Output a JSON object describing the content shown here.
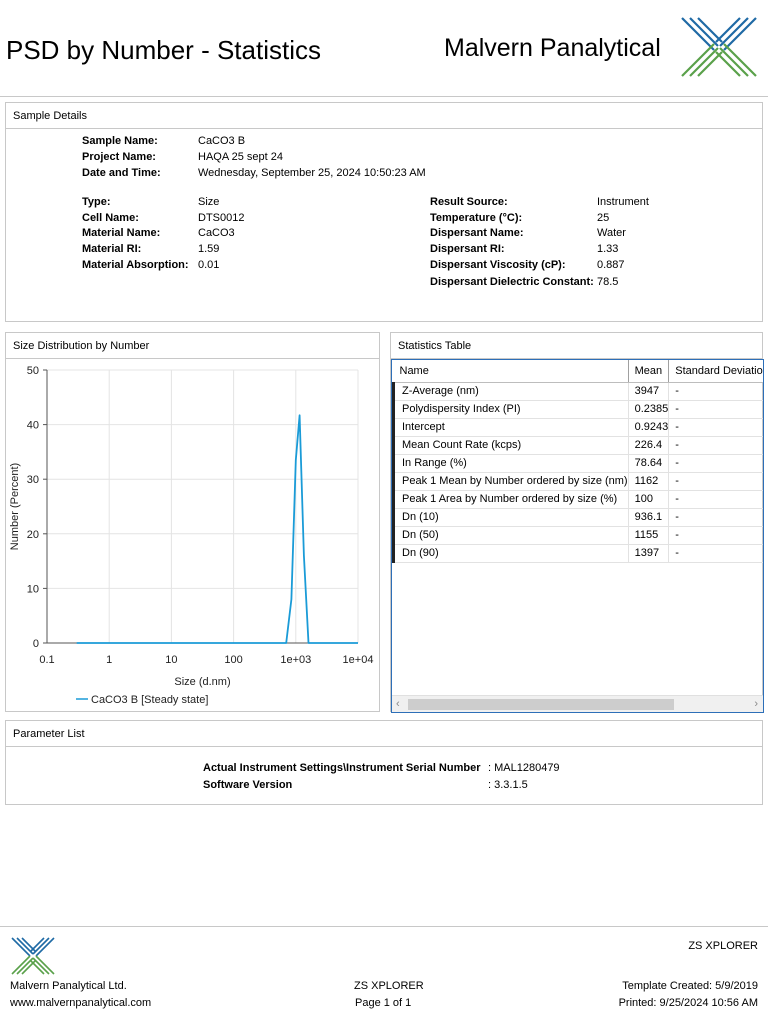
{
  "header": {
    "title": "PSD by Number - Statistics",
    "brand": "Malvern Panalytical"
  },
  "sample_details": {
    "panel_title": "Sample Details",
    "rows": [
      {
        "label": "Sample Name:",
        "value": "CaCO3 B"
      },
      {
        "label": "Project Name:",
        "value": "HAQA 25 sept 24"
      },
      {
        "label": "Date and Time:",
        "value": "Wednesday, September 25, 2024 10:50:23 AM"
      }
    ],
    "left_rows": [
      {
        "label": "Type:",
        "value": "Size"
      },
      {
        "label": "Cell Name:",
        "value": "DTS0012"
      },
      {
        "label": "Material Name:",
        "value": "CaCO3"
      },
      {
        "label": "Material RI:",
        "value": "1.59"
      },
      {
        "label": "Material Absorption:",
        "value": "0.01"
      }
    ],
    "right_rows": [
      {
        "label": "Result Source:",
        "value": "Instrument"
      },
      {
        "label": "Temperature (°C):",
        "value": "25"
      },
      {
        "label": "Dispersant Name:",
        "value": "Water"
      },
      {
        "label": "Dispersant RI:",
        "value": "1.33"
      },
      {
        "label": "Dispersant Viscosity (cP):",
        "value": "0.887"
      },
      {
        "label": "Dispersant Dielectric Constant:",
        "value": "78.5"
      }
    ]
  },
  "distribution": {
    "panel_title": "Size Distribution by Number"
  },
  "chart_data": {
    "type": "line",
    "title": "",
    "xlabel": "Size (d.nm)",
    "ylabel": "Number (Percent)",
    "x_scale": "log",
    "xlim": [
      0.1,
      10000
    ],
    "ylim": [
      0,
      50
    ],
    "x_ticks": [
      "0.1",
      "1",
      "10",
      "100",
      "1e+03",
      "1e+04"
    ],
    "y_ticks": [
      "0",
      "10",
      "20",
      "30",
      "40",
      "50"
    ],
    "grid": true,
    "legend_position": "bottom",
    "series": [
      {
        "name": "CaCO3 B [Steady state]",
        "color": "#1a9bd7",
        "x": [
          0.3,
          1,
          10,
          100,
          700,
          850,
          1000,
          1150,
          1350,
          1600,
          10000
        ],
        "y": [
          0,
          0,
          0,
          0,
          0,
          8,
          33.5,
          41.7,
          16,
          0,
          0
        ]
      }
    ]
  },
  "statistics": {
    "panel_title": "Statistics Table",
    "columns": [
      "Name",
      "Mean",
      "Standard Deviatio"
    ],
    "rows": [
      {
        "name": "Z-Average (nm)",
        "mean": "3947",
        "sd": "-"
      },
      {
        "name": "Polydispersity Index (PI)",
        "mean": "0.2385",
        "sd": "-"
      },
      {
        "name": "Intercept",
        "mean": "0.9243",
        "sd": "-"
      },
      {
        "name": "Mean Count Rate (kcps)",
        "mean": "226.4",
        "sd": "-"
      },
      {
        "name": "In Range (%)",
        "mean": "78.64",
        "sd": "-"
      },
      {
        "name": "Peak 1 Mean by Number ordered by size (nm)",
        "mean": "1162",
        "sd": "-"
      },
      {
        "name": "Peak 1 Area by Number ordered by size (%)",
        "mean": "100",
        "sd": "-"
      },
      {
        "name": "Dn (10)",
        "mean": "936.1",
        "sd": "-"
      },
      {
        "name": "Dn (50)",
        "mean": "1155",
        "sd": "-"
      },
      {
        "name": "Dn (90)",
        "mean": "1397",
        "sd": "-"
      }
    ],
    "scroll_left": "‹",
    "scroll_right": "›"
  },
  "parameters": {
    "panel_title": "Parameter List",
    "rows": [
      {
        "label": "Actual Instrument Settings\\Instrument Serial Number",
        "value": ": MAL1280479"
      },
      {
        "label": "Software Version",
        "value": ": 3.3.1.5"
      }
    ]
  },
  "footer": {
    "product_right": "ZS XPLORER",
    "company": "Malvern Panalytical Ltd.",
    "website": "www.malvernpanalytical.com",
    "product_center": "ZS XPLORER",
    "page": "Page 1 of 1",
    "template_created": "Template Created: 5/9/2019",
    "printed": "Printed: 9/25/2024 10:56 AM"
  },
  "colors": {
    "logo_blue": "#1f6aa5",
    "logo_green": "#5aa14a",
    "series_line": "#1a9bd7",
    "table_border": "#2d6fb8"
  }
}
